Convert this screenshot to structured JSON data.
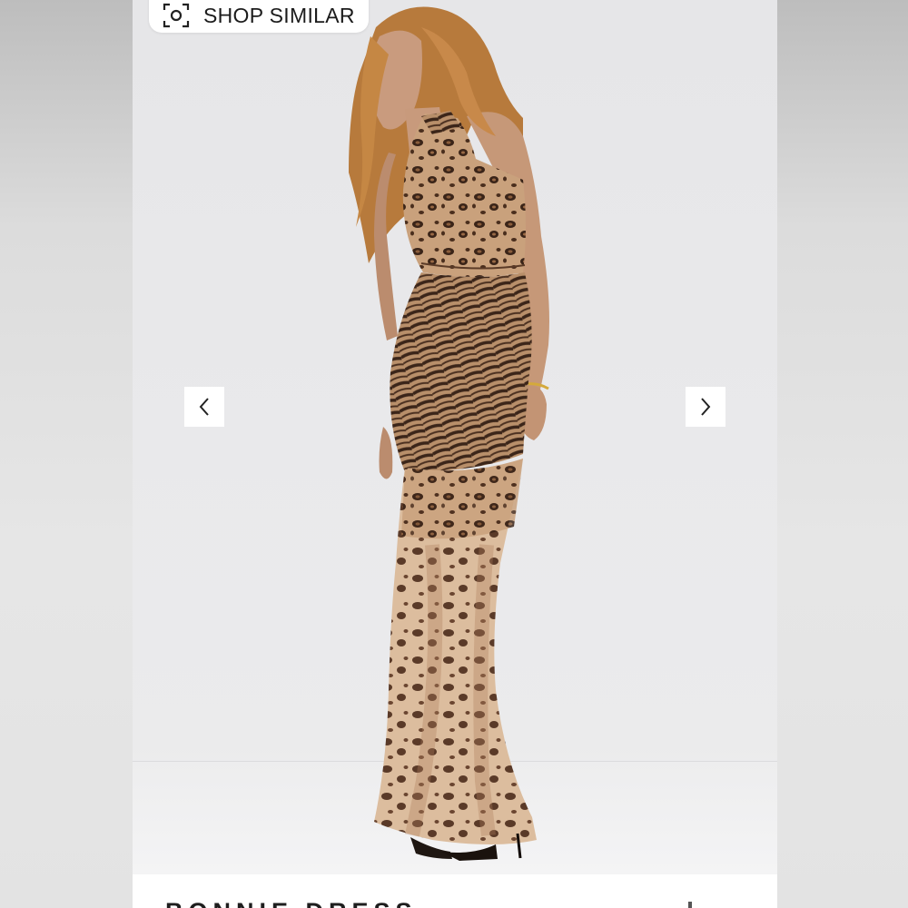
{
  "shop_similar": {
    "label": "SHOP SIMILAR",
    "icon": "camera-scan-icon"
  },
  "gallery": {
    "prev_icon": "chevron-left-icon",
    "next_icon": "chevron-right-icon"
  },
  "product": {
    "title": "BONNIE DRESS"
  },
  "colors": {
    "background": "#e4e4e4",
    "photo_bg": "#e9e9eb",
    "leopard_base": "#c9a17c",
    "leopard_spot": "#3a2418",
    "hair": "#b77a3c",
    "skin": "#c89a7c"
  }
}
